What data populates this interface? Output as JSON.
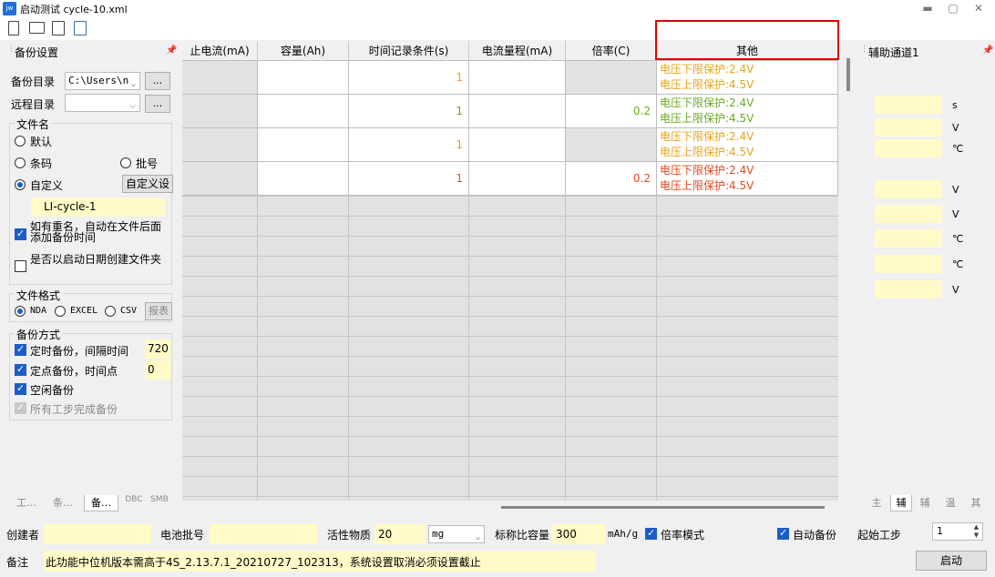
{
  "window": {
    "title": "启动测试 cycle-10.xml",
    "app_icon": "jw"
  },
  "toolbar": {
    "icons": [
      "new-file-icon",
      "open-folder-icon",
      "save-icon",
      "save-as-icon"
    ]
  },
  "left_panel": {
    "header": "备份设置",
    "backup_dir_label": "备份目录",
    "backup_dir_value": "C:\\Users\\n",
    "browse1": "...",
    "remote_dir_label": "远程目录",
    "remote_dir_value": "",
    "browse2": "...",
    "file_name_group": "文件名",
    "opt_default": "默认",
    "opt_barcode": "条码",
    "opt_batch": "批号",
    "opt_custom": "自定义",
    "custom_btn": "自定义设",
    "custom_name": "LI-cycle-1",
    "cb_rename": "如有重名，自动在文件后面添加备份时间",
    "cb_date_folder": "是否以启动日期创建文件夹",
    "format_group": "文件格式",
    "fmt_nda": "NDA",
    "fmt_excel": "EXCEL",
    "fmt_csv": "CSV",
    "report_btn": "报表",
    "method_group": "备份方式",
    "cb_timed": "定时备份，间隔时间",
    "timed_value": "720",
    "cb_point": "定点备份，时间点",
    "point_value": "0",
    "cb_idle": "空闲备份",
    "cb_all_steps": "所有工步完成备份",
    "tabs": [
      "工…",
      "条…",
      "备…",
      "DBC",
      "SMB"
    ]
  },
  "grid": {
    "columns": [
      "止电流(mA)",
      "容量(Ah)",
      "时间记录条件(s)",
      "电流量程(mA)",
      "倍率(C)",
      "其他"
    ],
    "rows": [
      {
        "time": "1",
        "rate": "",
        "o1": "电压下限保护:2.4V",
        "o2": "电压上限保护:4.5V",
        "color": "#e8a317",
        "shade": true
      },
      {
        "time": "1",
        "rate": "0.2",
        "o1": "电压下限保护:2.4V",
        "o2": "电压上限保护:4.5V",
        "color": "#6aaa1e",
        "shade": false
      },
      {
        "time": "1",
        "rate": "",
        "o1": "电压下限保护:2.4V",
        "o2": "电压上限保护:4.5V",
        "color": "#e8a317",
        "shade": true
      },
      {
        "time": "1",
        "rate": "0.2",
        "o1": "电压下限保护:2.4V",
        "o2": "电压上限保护:4.5V",
        "color": "#e04a1e",
        "shade": false
      }
    ]
  },
  "right_panel": {
    "header": "辅助通道1",
    "units": [
      "s",
      "V",
      "℃",
      "V",
      "V",
      "℃",
      "℃",
      "V"
    ],
    "tabs": [
      "主",
      "辅",
      "辅",
      "温",
      "其"
    ]
  },
  "bottom": {
    "creator_label": "创建者",
    "creator_value": "",
    "batch_label": "电池批号",
    "batch_value": "",
    "active_label": "活性物质",
    "active_value": "20",
    "active_unit": "mg",
    "capacity_label": "标称比容量",
    "capacity_value": "300",
    "capacity_unit": "mAh/g",
    "rate_mode": "倍率模式",
    "auto_backup": "自动备份",
    "start_step_label": "起始工步",
    "start_step_value": "1",
    "note_label": "备注",
    "note_value": "此功能中位机版本需高于4S_2.13.7.1_20210727_102313，系统设置取消必须设置截止",
    "start_button": "启动"
  },
  "colors": {
    "highlight_box": "#e00000",
    "accent": "#1a5ec8",
    "yellow_field": "#fffac8"
  }
}
